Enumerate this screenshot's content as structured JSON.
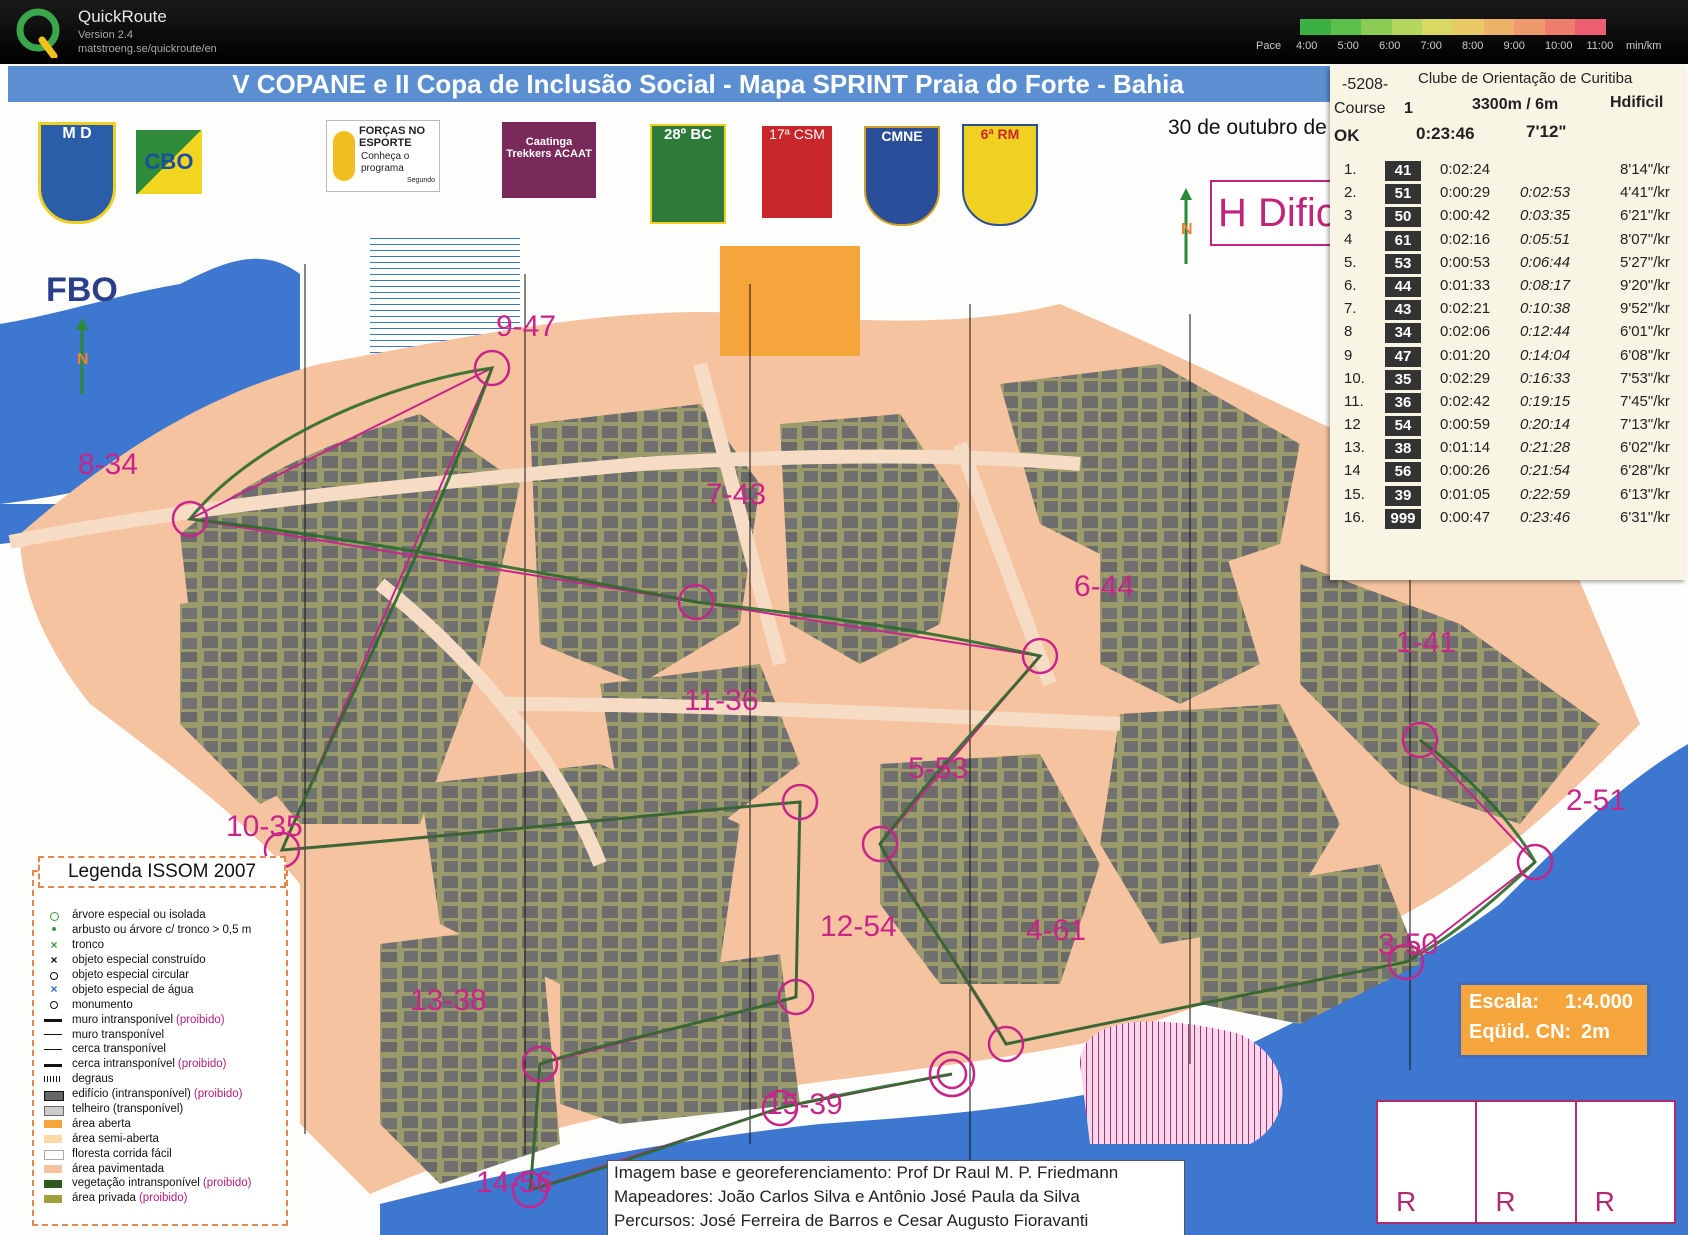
{
  "app": {
    "name": "QuickRoute",
    "version": "Version 2.4",
    "url": "matstroeng.se/quickroute/en"
  },
  "pace": {
    "label": "Pace",
    "ticks": [
      "4:00",
      "5:00",
      "6:00",
      "7:00",
      "8:00",
      "9:00",
      "10:00",
      "11:00"
    ],
    "unit": "min/km",
    "colors": [
      "#3cb043",
      "#5cc04a",
      "#8ccc55",
      "#b5d65d",
      "#d9d862",
      "#e8c964",
      "#ecb268",
      "#ee9a6c",
      "#ef7d6e",
      "#ec5f70"
    ]
  },
  "map": {
    "title": "V COPANE  e II Copa de Inclusão Social - Mapa SPRINT Praia do Forte - Bahia",
    "date": "30 de outubro de",
    "class_label": "H Difici",
    "sponsors": [
      "M D",
      "CBO",
      "FORÇAS NO ESPORTE",
      "FBO",
      "Caatinga Trekkers ACAAT",
      "28º BC",
      "17ª CSM",
      "CMNE",
      "6ª RM"
    ],
    "sponsor_texts": {
      "forcas_sub": "Conheça o programa",
      "forcas_corner": "Segundo"
    },
    "controls": [
      {
        "label": "1-41"
      },
      {
        "label": "2-51"
      },
      {
        "label": "3-50"
      },
      {
        "label": "4-61"
      },
      {
        "label": "5-53"
      },
      {
        "label": "6-44"
      },
      {
        "label": "7-43"
      },
      {
        "label": "8-34"
      },
      {
        "label": "9-47"
      },
      {
        "label": "10-35"
      },
      {
        "label": "11-36"
      },
      {
        "label": "12-54"
      },
      {
        "label": "13-38"
      },
      {
        "label": "14-56"
      },
      {
        "label": "15-39"
      }
    ],
    "scale": {
      "label1": "Escala:",
      "value1": "1:4.000",
      "label2": "Eqüid. CN:",
      "value2": "2m"
    },
    "credits": [
      "Imagem base e georeferenciamento: Prof Dr Raul M. P. Friedmann",
      "Mapeadores: João Carlos Silva e Antônio José Paula da Silva",
      "Percursos: José Ferreira de Barros e Cesar Augusto Fioravanti"
    ],
    "r_boxes": [
      "R",
      "R",
      "R"
    ],
    "north_label": "N"
  },
  "legend": {
    "title": "Legenda ISSOM 2007",
    "items": [
      {
        "text": "árvore especial ou isolada",
        "sym": "circle-green"
      },
      {
        "text": "arbusto ou árvore c/ tronco > 0,5 m",
        "sym": "dot-green"
      },
      {
        "text": "tronco",
        "sym": "x-green"
      },
      {
        "text": "objeto especial construído",
        "sym": "x-black"
      },
      {
        "text": "objeto especial circular",
        "sym": "o-black"
      },
      {
        "text": "objeto especial de água",
        "sym": "x-blue"
      },
      {
        "text": "monumento",
        "sym": "o-black"
      },
      {
        "text": "muro intransponível",
        "red": "(proibido)",
        "sym": "line-thick"
      },
      {
        "text": "muro transponível",
        "sym": "line-thin"
      },
      {
        "text": "cerca transponível",
        "sym": "fence"
      },
      {
        "text": "cerca intransponível",
        "red": "(proibido)",
        "sym": "fence-thick"
      },
      {
        "text": "degraus",
        "sym": "steps"
      },
      {
        "text": "edifício (intransponível)",
        "red": "(proibido)",
        "sym": "building"
      },
      {
        "text": "telheiro (transponível)",
        "sym": "canopy"
      },
      {
        "text": "área aberta",
        "sym": "open"
      },
      {
        "text": "área semi-aberta",
        "sym": "semiopen"
      },
      {
        "text": "floresta corrida fácil",
        "sym": "forest"
      },
      {
        "text": "área pavimentada",
        "sym": "paved"
      },
      {
        "text": "vegetação intransponível",
        "red": "(proibido)",
        "sym": "veg"
      },
      {
        "text": "área privada",
        "red": "(proibido)",
        "sym": "private"
      }
    ]
  },
  "splits": {
    "event_code": "-5208-",
    "club": "Clube de Orientação de Curitiba",
    "course_label": "Course",
    "course_no": "1",
    "course_len": "3300m / 6m",
    "class": "Hdificil",
    "status": "OK",
    "total_time": "0:23:46",
    "avg_pace": "7'12\"",
    "rows": [
      {
        "n": "1.",
        "code": "41",
        "split": "0:02:24",
        "cum": "",
        "pace": "8'14\"/kr"
      },
      {
        "n": "2.",
        "code": "51",
        "split": "0:00:29",
        "cum": "0:02:53",
        "pace": "4'41\"/kr"
      },
      {
        "n": "3",
        "code": "50",
        "split": "0:00:42",
        "cum": "0:03:35",
        "pace": "6'21\"/kr"
      },
      {
        "n": "4",
        "code": "61",
        "split": "0:02:16",
        "cum": "0:05:51",
        "pace": "8'07\"/kr"
      },
      {
        "n": "5.",
        "code": "53",
        "split": "0:00:53",
        "cum": "0:06:44",
        "pace": "5'27\"/kr"
      },
      {
        "n": "6.",
        "code": "44",
        "split": "0:01:33",
        "cum": "0:08:17",
        "pace": "9'20\"/kr"
      },
      {
        "n": "7.",
        "code": "43",
        "split": "0:02:21",
        "cum": "0:10:38",
        "pace": "9'52\"/kr"
      },
      {
        "n": "8",
        "code": "34",
        "split": "0:02:06",
        "cum": "0:12:44",
        "pace": "6'01\"/kr"
      },
      {
        "n": "9",
        "code": "47",
        "split": "0:01:20",
        "cum": "0:14:04",
        "pace": "6'08\"/kr"
      },
      {
        "n": "10.",
        "code": "35",
        "split": "0:02:29",
        "cum": "0:16:33",
        "pace": "7'53\"/kr"
      },
      {
        "n": "11.",
        "code": "36",
        "split": "0:02:42",
        "cum": "0:19:15",
        "pace": "7'45\"/kr"
      },
      {
        "n": "12",
        "code": "54",
        "split": "0:00:59",
        "cum": "0:20:14",
        "pace": "7'13\"/kr"
      },
      {
        "n": "13.",
        "code": "38",
        "split": "0:01:14",
        "cum": "0:21:28",
        "pace": "6'02\"/kr"
      },
      {
        "n": "14",
        "code": "56",
        "split": "0:00:26",
        "cum": "0:21:54",
        "pace": "6'28\"/kr"
      },
      {
        "n": "15.",
        "code": "39",
        "split": "0:01:05",
        "cum": "0:22:59",
        "pace": "6'13\"/kr"
      },
      {
        "n": "16.",
        "code": "999",
        "split": "0:00:47",
        "cum": "0:23:46",
        "pace": "6'31\"/kr"
      }
    ]
  }
}
